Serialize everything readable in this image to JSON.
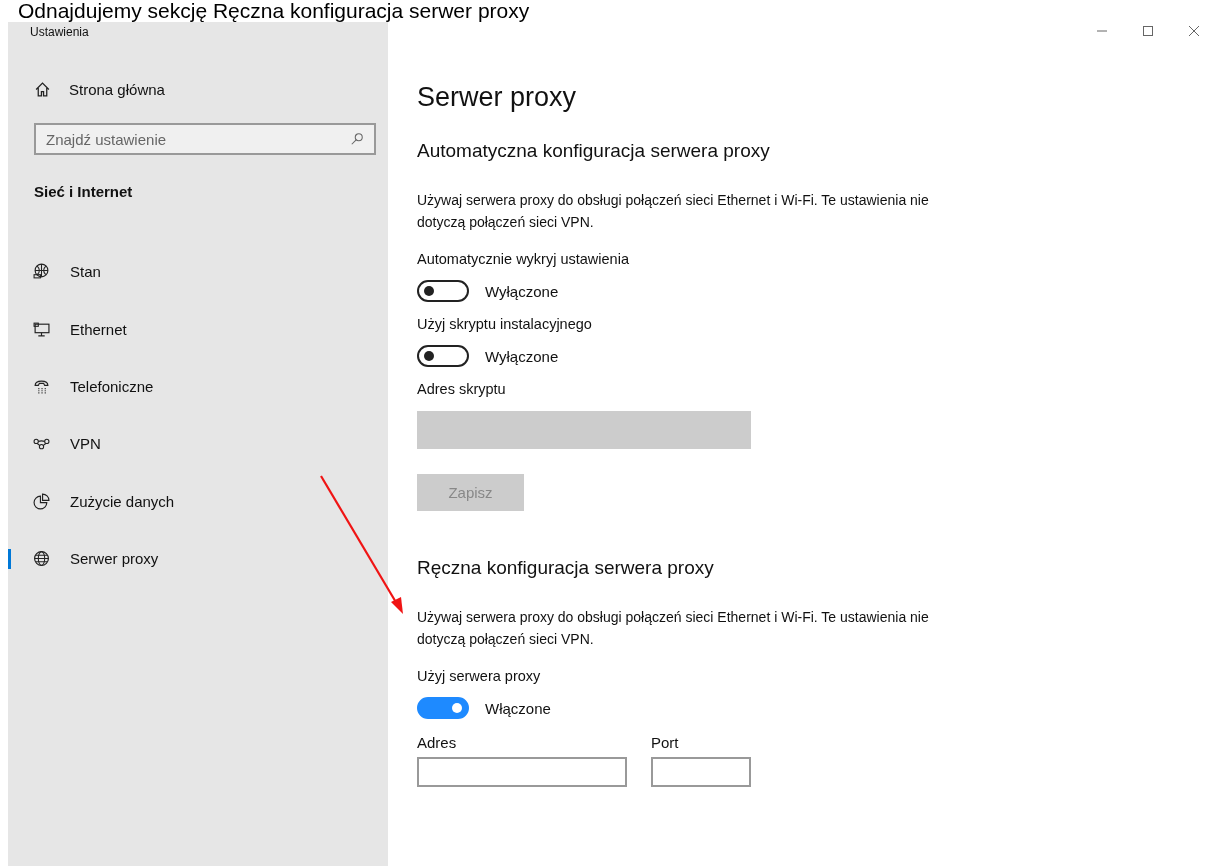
{
  "caption": "Odnajdujemy sekcję Ręczna konfiguracja serwer proxy",
  "window": {
    "title": "Ustawienia"
  },
  "sidebar": {
    "home": "Strona główna",
    "search": {
      "placeholder": "Znajdź ustawienie"
    },
    "category": "Sieć i Internet",
    "items": [
      {
        "label": "Stan",
        "selected": false
      },
      {
        "label": "Ethernet",
        "selected": false
      },
      {
        "label": "Telefoniczne",
        "selected": false
      },
      {
        "label": "VPN",
        "selected": false
      },
      {
        "label": "Zużycie danych",
        "selected": false
      },
      {
        "label": "Serwer proxy",
        "selected": true
      }
    ]
  },
  "page": {
    "title": "Serwer proxy",
    "automatic": {
      "heading": "Automatyczna konfiguracja serwera proxy",
      "description": "Używaj serwera proxy do obsługi połączeń sieci Ethernet i Wi-Fi. Te ustawienia nie dotyczą połączeń sieci VPN.",
      "toggles": [
        {
          "label": "Automatycznie wykryj ustawienia",
          "on": false,
          "state_text": "Wyłączone"
        },
        {
          "label": "Użyj skryptu instalacyjnego",
          "on": false,
          "state_text": "Wyłączone"
        }
      ],
      "script_field": {
        "label": "Adres skryptu",
        "disabled": true
      },
      "save_button": {
        "label": "Zapisz",
        "disabled": true
      }
    },
    "manual": {
      "heading": "Ręczna konfiguracja serwera proxy",
      "description": "Używaj serwera proxy do obsługi połączeń sieci Ethernet i Wi-Fi. Te ustawienia nie dotyczą połączeń sieci VPN.",
      "toggles": [
        {
          "label": "Użyj serwera proxy",
          "on": true,
          "state_text": "Włączone"
        }
      ],
      "address_label": "Adres",
      "port_label": "Port"
    }
  }
}
